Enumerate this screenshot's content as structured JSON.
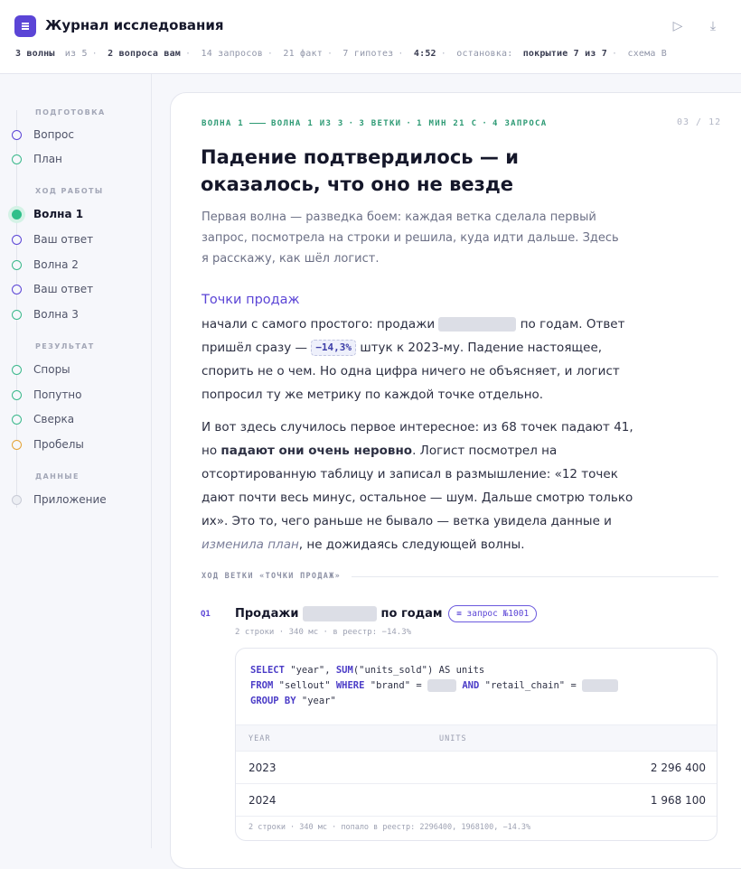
{
  "header": {
    "title": "Журнал исследования",
    "status": {
      "waves_done": "3 волны",
      "waves_total": "из 5",
      "questions": "2 вопроса вам",
      "requests": "14 запросов",
      "facts": "21 факт",
      "hypotheses": "7 гипотез",
      "time": "4:52",
      "stop_label": "остановка:",
      "stop_value": "покрытие 7 из 7",
      "scheme": "схема B"
    },
    "play_icon": "▷",
    "download_icon": "⤓"
  },
  "sidebar": {
    "sections": {
      "prep": "ПОДГОТОВКА",
      "work": "ХОД РАБОТЫ",
      "result": "РЕЗУЛЬТАТ",
      "data": "ДАННЫЕ"
    },
    "items": [
      {
        "label": "Вопрос",
        "state": "purple"
      },
      {
        "label": "План",
        "state": "green"
      },
      {
        "label": "Волна 1",
        "state": "active"
      },
      {
        "label": "Ваш ответ",
        "state": "purple"
      },
      {
        "label": "Волна 2",
        "state": "green"
      },
      {
        "label": "Ваш ответ",
        "state": "purple"
      },
      {
        "label": "Волна 3",
        "state": "green"
      },
      {
        "label": "Споры",
        "state": "green"
      },
      {
        "label": "Попутно",
        "state": "green"
      },
      {
        "label": "Сверка",
        "state": "green"
      },
      {
        "label": "Пробелы",
        "state": "orange"
      },
      {
        "label": "Приложение",
        "state": "gray"
      }
    ]
  },
  "card": {
    "kicker_wave": "ВОЛНА 1",
    "kicker_detail": "ВОЛНА 1 ИЗ 3",
    "kicker_branches": "3 ВЕТКИ",
    "kicker_time": "1 МИН 21 С",
    "kicker_requests": "4 ЗАПРОСА",
    "pager": "03 / 12",
    "title": "Падение подтвердилось — и оказалось, что оно не везде",
    "lede": "Первая волна — разведка боем: каждая ветка сделала первый запрос, посмотрела на строки и решила, куда идти дальше. Здесь я расскажу, как шёл логист.",
    "section_title": "Точки продаж",
    "p1_a": "начали с самого простого: продажи",
    "p1_b": "по годам. Ответ пришёл сразу —",
    "p1_chip": "−14,3%",
    "p1_c": "штук к 2023-му. Падение настоящее, спорить не о чем. Но одна цифра ничего не объясняет, и логист попросил ту же метрику по каждой точке отдельно.",
    "p2_a": "И вот здесь случилось первое интересное: из 68 точек падают 41, но",
    "p2_bold": "падают они очень неровно",
    "p2_b": ". Логист посмотрел на отсортированную таблицу и записал в размышление: «12 точек дают почти весь минус, остальное — шум. Дальше смотрю только их». Это то, чего раньше не бывало — ветка увидела данные и",
    "p2_em": "изменила план",
    "p2_c": ", не дожидаясь следующей волны.",
    "trace_head": "ХОД ВЕТКИ «ТОЧКИ ПРОДАЖ»"
  },
  "query": {
    "tag": "Q1",
    "title_a": "Продажи",
    "title_b": "по годам",
    "request_chip": "≡ запрос №1001",
    "meta": "2 строки · 340 мс · в реестр: −14.3%",
    "code": {
      "kw_select": "SELECT",
      "l1_a": " \"year\", ",
      "kw_sum": "SUM",
      "l1_b": "(\"units_sold\") AS units",
      "kw_from": "FROM",
      "l2_a": " \"sellout\" ",
      "kw_where": "WHERE",
      "l2_b": " \"brand\" = ",
      "kw_and": "AND",
      "l2_c": " \"retail_chain\" = ",
      "kw_group": "GROUP BY",
      "l3": " \"year\""
    },
    "columns": [
      "YEAR",
      "UNITS"
    ],
    "rows": [
      {
        "year": "2023",
        "units": "2 296 400"
      },
      {
        "year": "2024",
        "units": "1 968 100"
      }
    ],
    "footer": "2 строки · 340 мс · попало в реестр: 2296400, 1968100, −14.3%"
  }
}
